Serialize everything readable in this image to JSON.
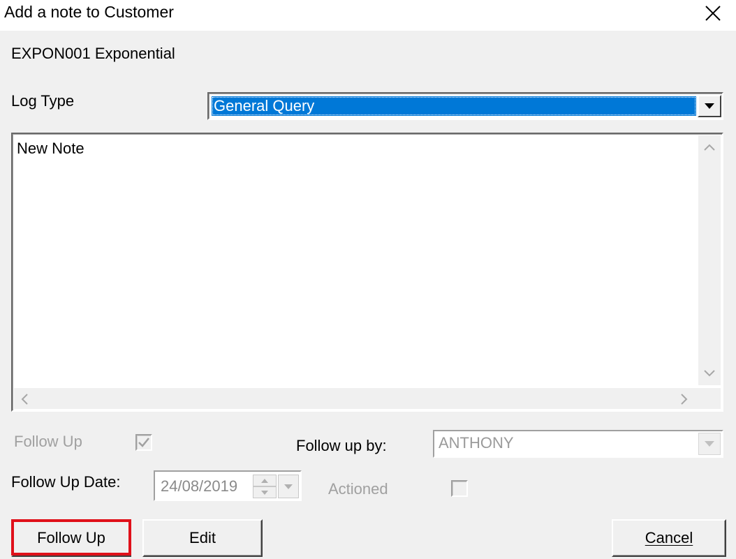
{
  "window": {
    "title": "Add a note to Customer",
    "close_icon": "close-icon"
  },
  "customer": {
    "label": "EXPON001 Exponential"
  },
  "log_type": {
    "label": "Log Type",
    "selected": "General Query"
  },
  "note": {
    "text": "New Note"
  },
  "follow_up": {
    "label": "Follow Up",
    "checked": true,
    "by_label": "Follow up by:",
    "by_value": "ANTHONY",
    "date_label": "Follow Up Date:",
    "date_value": "24/08/2019",
    "actioned_label": "Actioned",
    "actioned_checked": false
  },
  "buttons": {
    "follow_up": "Follow Up",
    "edit": "Edit",
    "cancel": "Cancel"
  },
  "colors": {
    "selection": "#0078d7",
    "highlight_border": "#e0101a"
  }
}
